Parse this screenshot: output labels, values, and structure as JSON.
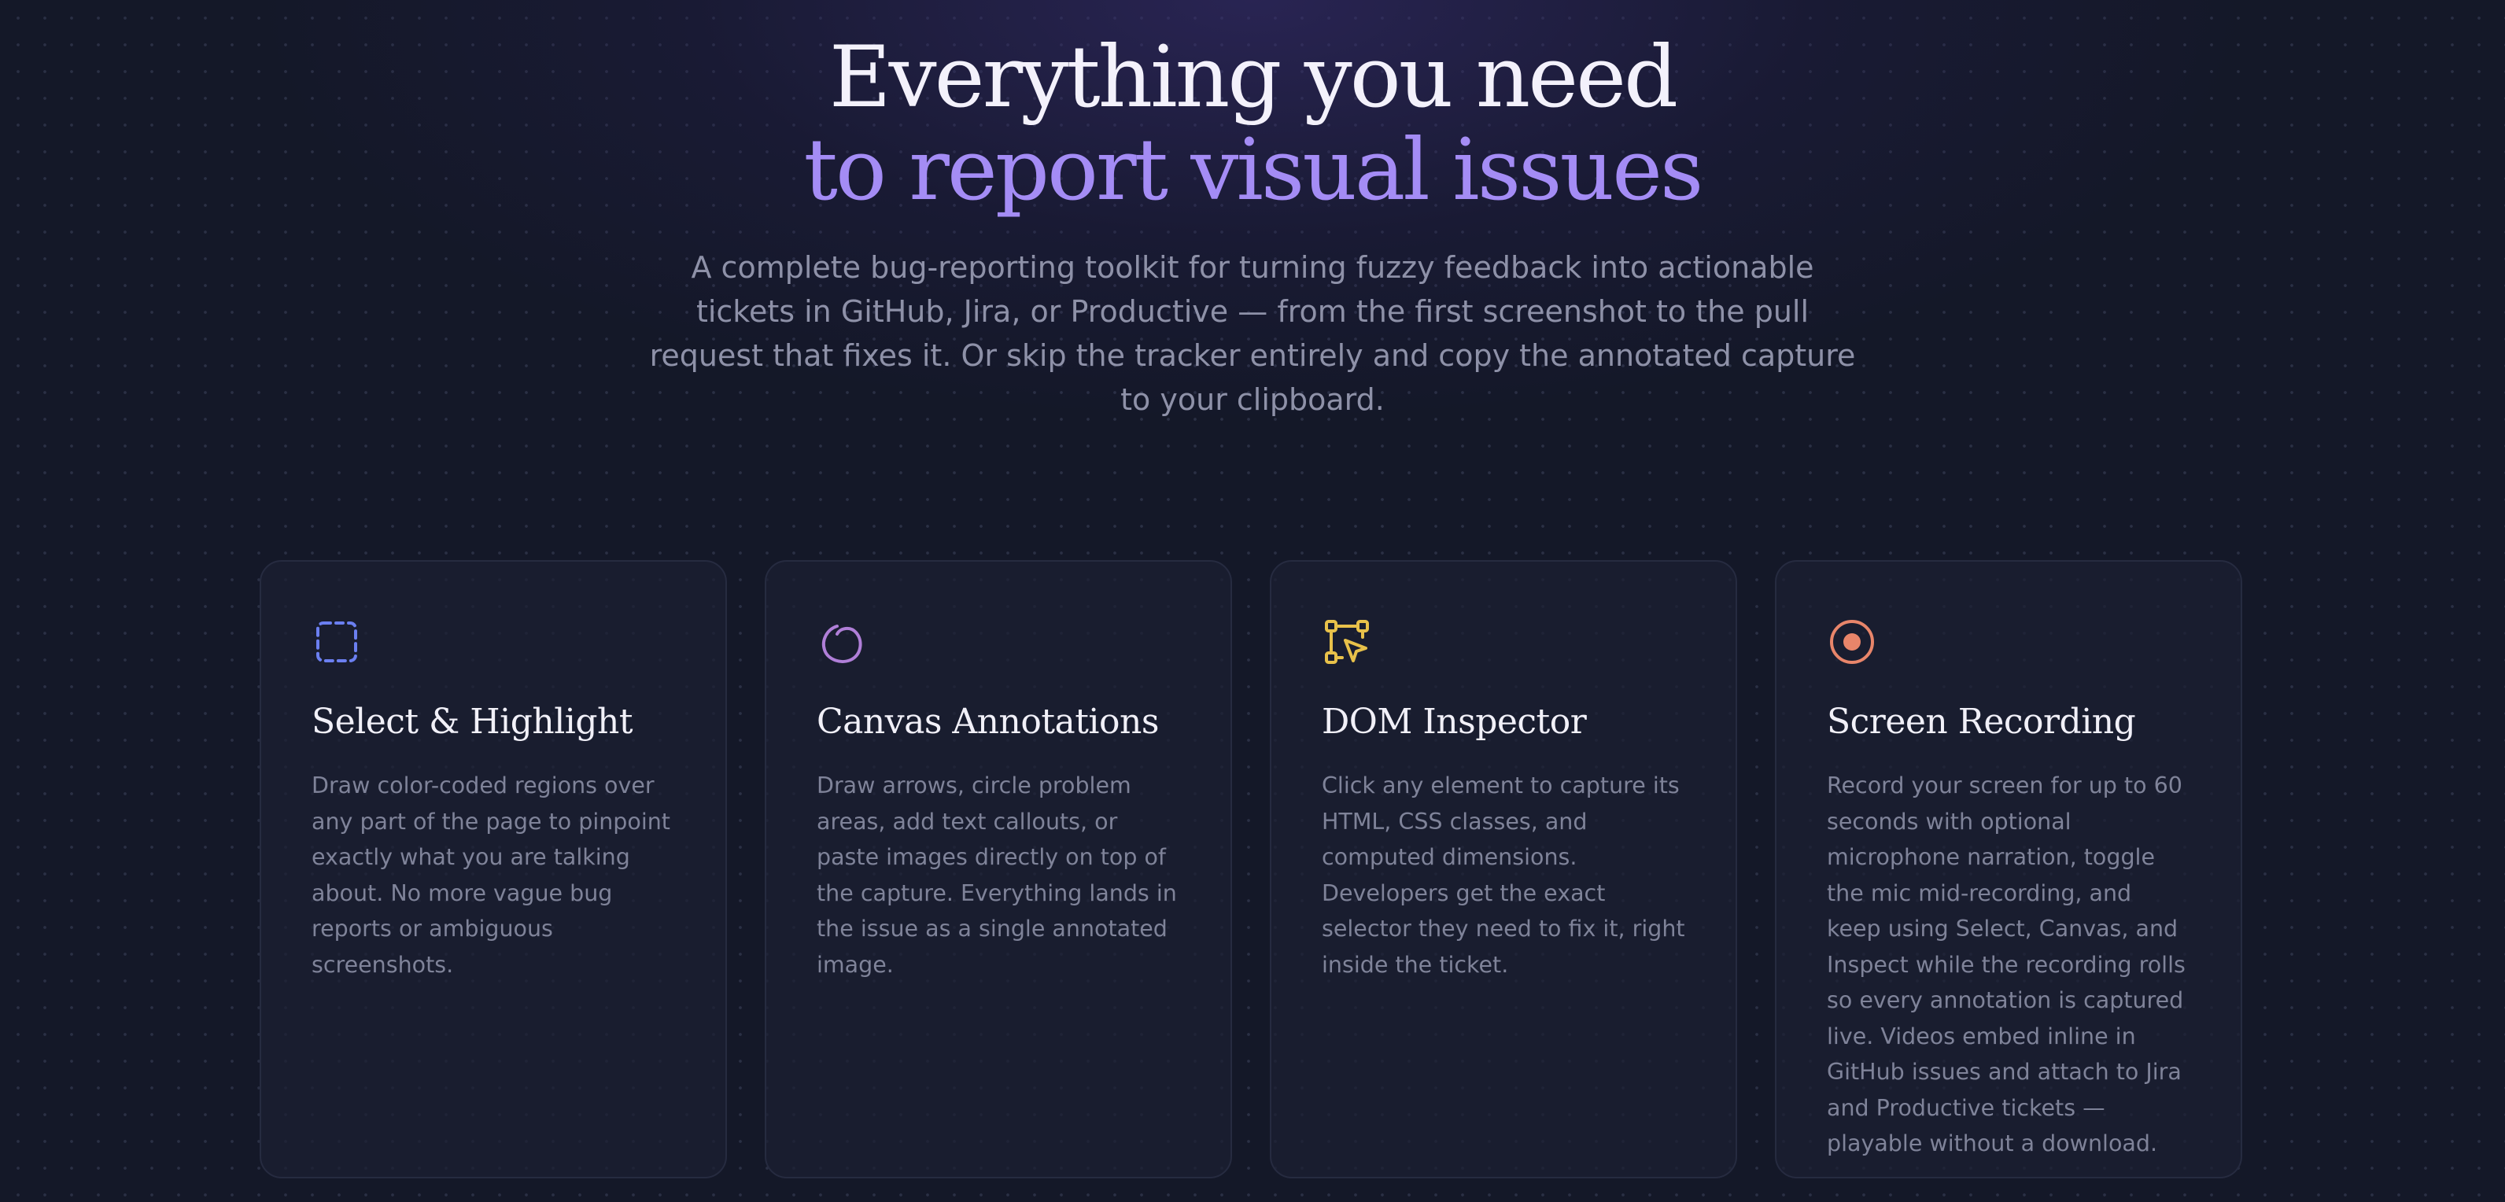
{
  "hero": {
    "title_line_1": "Everything you need",
    "title_line_2": "to report visual issues",
    "subtitle": "A complete bug-reporting toolkit for turning fuzzy feedback into actionable tickets in GitHub, Jira, or Productive — from the first screenshot to the pull request that fixes it. Or skip the tracker entirely and copy the annotated capture to your clipboard."
  },
  "features": [
    {
      "icon": "dashed-selection-icon",
      "icon_color": "#6b7ff0",
      "title": "Select & Highlight",
      "description": "Draw color-coded regions over any part of the page to pinpoint exactly what you are talking about. No more vague bug reports or ambiguous screenshots."
    },
    {
      "icon": "freehand-circle-icon",
      "icon_color": "#b07fd8",
      "title": "Canvas Annotations",
      "description": "Draw arrows, circle problem areas, add text callouts, or paste images directly on top of the capture. Everything lands in the issue as a single annotated image."
    },
    {
      "icon": "element-cursor-icon",
      "icon_color": "#e8c14a",
      "title": "DOM Inspector",
      "description": "Click any element to capture its HTML, CSS classes, and computed dimensions. Developers get the exact selector they need to fix it, right inside the ticket."
    },
    {
      "icon": "record-icon",
      "icon_color": "#e8856a",
      "title": "Screen Recording",
      "description": "Record your screen for up to 60 seconds with optional microphone narration, toggle the mic mid-recording, and keep using Select, Canvas, and Inspect while the recording rolls so every annotation is captured live. Videos embed inline in GitHub issues and attach to Jira and Productive tickets — playable without a download."
    }
  ]
}
